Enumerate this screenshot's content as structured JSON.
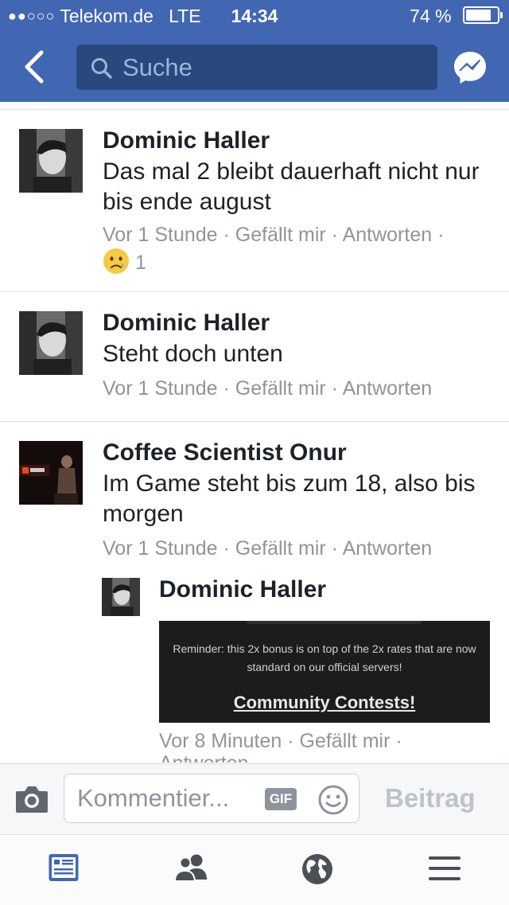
{
  "status_bar": {
    "signal": "●●○○○",
    "carrier": "Telekom.de",
    "network": "LTE",
    "time": "14:34",
    "battery_text": "74 %",
    "battery_level": 0.74
  },
  "header": {
    "search_placeholder": "Suche",
    "color": "#4267b2"
  },
  "comments": [
    {
      "name": "Dominic Haller",
      "text": "Das mal 2 bleibt dauerhaft nicht nur bis ende august",
      "time": "Vor 1 Stunde",
      "like": "Gefällt mir",
      "reply": "Antworten",
      "separator": "·",
      "reaction_count": "1",
      "reaction_icon": "sad-emoji-icon"
    },
    {
      "name": "Dominic Haller",
      "text": "Steht doch unten",
      "time": "Vor 1 Stunde",
      "like": "Gefällt mir",
      "reply": "Antworten",
      "separator": "·"
    },
    {
      "name": "Coffee Scientist Onur",
      "text": "Im Game steht bis zum 18, also bis morgen",
      "time": "Vor 1 Stunde",
      "like": "Gefällt mir",
      "reply": "Antworten",
      "separator": "·"
    }
  ],
  "reply": {
    "name": "Dominic Haller",
    "image_reminder": "Reminder: this 2x bonus is on top of the 2x rates that are now standard on our official servers!",
    "image_heading": "Community Contests!",
    "time": "Vor 8 Minuten",
    "like": "Gefällt mir",
    "reply": "Antworten",
    "separator": "·"
  },
  "composer": {
    "placeholder": "Kommentier...",
    "gif_label": "GIF",
    "post_label": "Beitrag"
  },
  "tabbar": {
    "items": [
      "news-feed-icon",
      "friends-icon",
      "globe-icon",
      "menu-icon"
    ],
    "active_color": "#4267b2",
    "inactive_color": "#4b4f56"
  }
}
